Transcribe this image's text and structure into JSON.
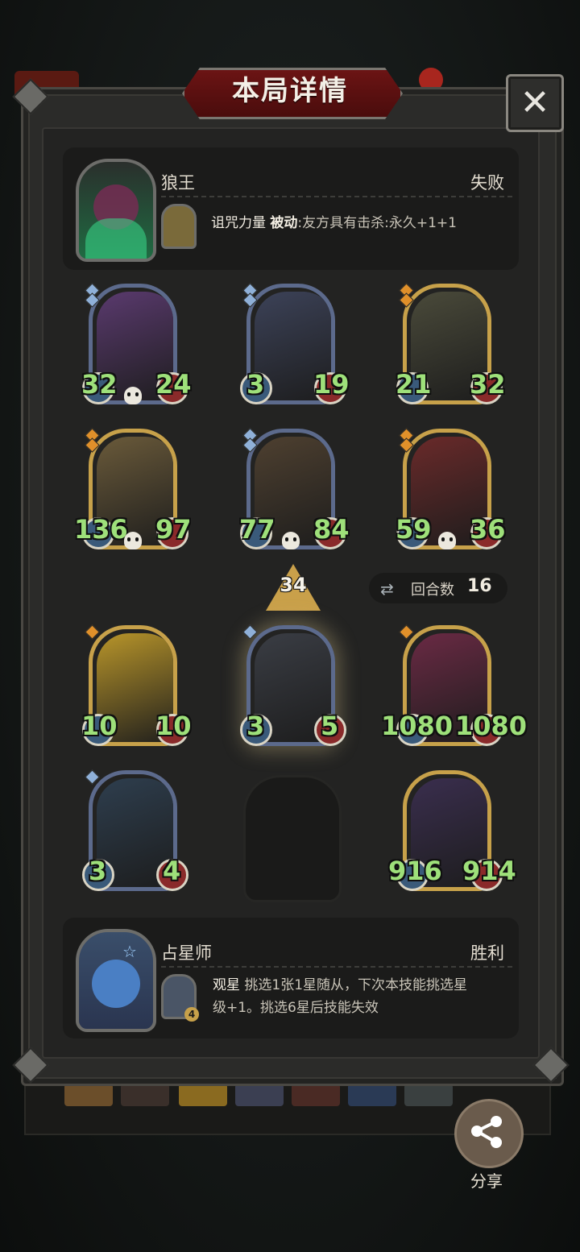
{
  "dialog": {
    "title": "本局详情",
    "close_label": "✕"
  },
  "opponent": {
    "name": "狼王",
    "result": "失败",
    "skill_name": "诅咒力量",
    "skill_type": "被动",
    "skill_desc": ":友方具有击杀:永久+1+1"
  },
  "player": {
    "name": "占星师",
    "result": "胜利",
    "skill_name": "观星",
    "skill_desc_line1": "挑选1张1星随从，下次本技能挑选星",
    "skill_desc_line2": "级+1。挑选6星后技能失效",
    "skill_badge": "4"
  },
  "opponent_board": [
    {
      "attack": "32",
      "health": "24",
      "frame": "silver",
      "gems": 2,
      "dead": true
    },
    {
      "attack": "3",
      "health": "19",
      "frame": "silver",
      "gems": 2,
      "dead": false
    },
    {
      "attack": "21",
      "health": "32",
      "frame": "gold",
      "gems": 2,
      "dead": false
    },
    {
      "attack": "136",
      "health": "97",
      "frame": "gold",
      "gems": 2,
      "dead": true
    },
    {
      "attack": "77",
      "health": "84",
      "frame": "silver",
      "gems": 2,
      "dead": true
    },
    {
      "attack": "59",
      "health": "36",
      "frame": "gold",
      "gems": 2,
      "dead": true
    }
  ],
  "player_board": [
    {
      "attack": "10",
      "health": "10",
      "frame": "gold",
      "gems": 1
    },
    {
      "attack": "3",
      "health": "5",
      "frame": "silver",
      "gems": 1
    },
    {
      "attack": "1080",
      "health": "1080",
      "frame": "gold",
      "gems": 1
    },
    {
      "attack": "3",
      "health": "4",
      "frame": "silver",
      "gems": 1
    },
    {
      "attack": "916",
      "health": "914",
      "frame": "gold",
      "gems": 0
    }
  ],
  "damage": "34",
  "rounds": {
    "label": "回合数",
    "value": "16",
    "icon": "swap-rounds-icon"
  },
  "share": {
    "label": "分享",
    "icon": "share-icon"
  },
  "colors": {
    "gold_frame": "#c7a14a",
    "silver_frame": "#5c6a8c",
    "stat_green": "#9ee07a",
    "title_red": "#6b1414"
  }
}
